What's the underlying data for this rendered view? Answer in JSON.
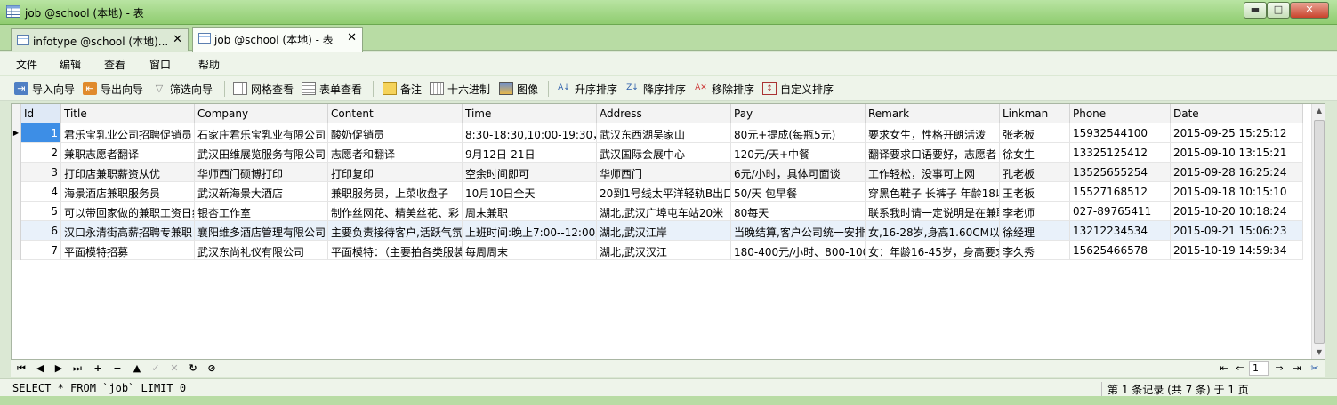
{
  "window": {
    "title": "job @school (本地) - 表",
    "controls": {
      "minimize": "▬",
      "maximize": "□",
      "close": "✕"
    }
  },
  "tabs": [
    {
      "label": "infotype @school (本地)...",
      "close": "✕",
      "active": false
    },
    {
      "label": "job @school (本地) - 表",
      "close": "✕",
      "active": true
    }
  ],
  "menu": [
    "文件",
    "编辑",
    "查看",
    "窗口",
    "帮助"
  ],
  "toolbar": {
    "import": "导入向导",
    "export": "导出向导",
    "filter": "筛选向导",
    "grid_view": "网格查看",
    "form_view": "表单查看",
    "memo": "备注",
    "hex": "十六进制",
    "image": "图像",
    "sort_asc": "升序排序",
    "sort_desc": "降序排序",
    "remove_sort": "移除排序",
    "custom_sort": "自定义排序"
  },
  "grid": {
    "columns": [
      "Id",
      "Title",
      "Company",
      "Content",
      "Time",
      "Address",
      "Pay",
      "Remark",
      "Linkman",
      "Phone",
      "Date"
    ],
    "rows": [
      [
        "1",
        "君乐宝乳业公司招聘促销员",
        "石家庄君乐宝乳业有限公司",
        "酸奶促销员",
        "8:30-18:30,10:00-19:30，中",
        "武汉东西湖吴家山",
        "80元+提成(每瓶5元)",
        "要求女生，性格开朗活泼",
        "张老板",
        "15932544100",
        "2015-09-25 15:25:12"
      ],
      [
        "2",
        "兼职志愿者翻译",
        "武汉田维展览服务有限公司",
        "志愿者和翻译",
        "9月12日-21日",
        "武汉国际会展中心",
        "120元/天+中餐",
        "翻译要求口语要好，志愿者",
        "徐女生",
        "13325125412",
        "2015-09-10 13:15:21"
      ],
      [
        "3",
        "打印店兼职薪资从优",
        "华师西门硕博打印",
        "打印复印",
        "空余时间即可",
        "华师西门",
        "6元/小时，具体可面谈",
        "工作轻松，没事可上网",
        "孔老板",
        "13525655254",
        "2015-09-28 16:25:24"
      ],
      [
        "4",
        "海景酒店兼职服务员",
        "武汉新海景大酒店",
        "兼职服务员，上菜收盘子",
        "10月10日全天",
        "20到1号线太平洋轻轨B出口",
        "50/天 包早餐",
        "穿黑色鞋子 长裤子 年龄18以",
        "王老板",
        "15527168512",
        "2015-09-18 10:15:10"
      ],
      [
        "5",
        "可以带回家做的兼职工资日结",
        "银杏工作室",
        "制作丝网花、精美丝花、彩",
        "周末兼职",
        "湖北,武汉广埠屯车站20米",
        "80每天",
        "联系我时请一定说明是在兼职",
        "李老师",
        "027-89765411",
        "2015-10-20 10:18:24"
      ],
      [
        "6",
        "汉口永清街高薪招聘专兼职",
        "襄阳维多酒店管理有限公司",
        "主要负责接待客户,活跃气氛",
        "上班时间:晚上7:00--12:00点",
        "湖北,武汉江岸",
        "当晚结算,客户公司统一安排",
        "女,16-28岁,身高1.60CM以上",
        "徐经理",
        "13212234534",
        "2015-09-21 15:06:23"
      ],
      [
        "7",
        "平面模特招募",
        "武汉东尚礼仪有限公司",
        "平面模特：（主要拍各类服装",
        "每周周末",
        "湖北,武汉汉江",
        "180-400元/小时、800-1000",
        "女：年龄16-45岁，身高要求",
        "李久秀",
        "15625466578",
        "2015-10-19 14:59:34"
      ]
    ]
  },
  "navigator": {
    "buttons": [
      "⏮",
      "◀",
      "▶",
      "⏭",
      "+",
      "−",
      "▲",
      "✓",
      "✕",
      "↻",
      "⊘"
    ],
    "page": "1"
  },
  "status": {
    "sql": "SELECT * FROM `job` LIMIT 0, 100",
    "record_info": "第 1 条记录 (共 7 条) 于 1 页"
  }
}
